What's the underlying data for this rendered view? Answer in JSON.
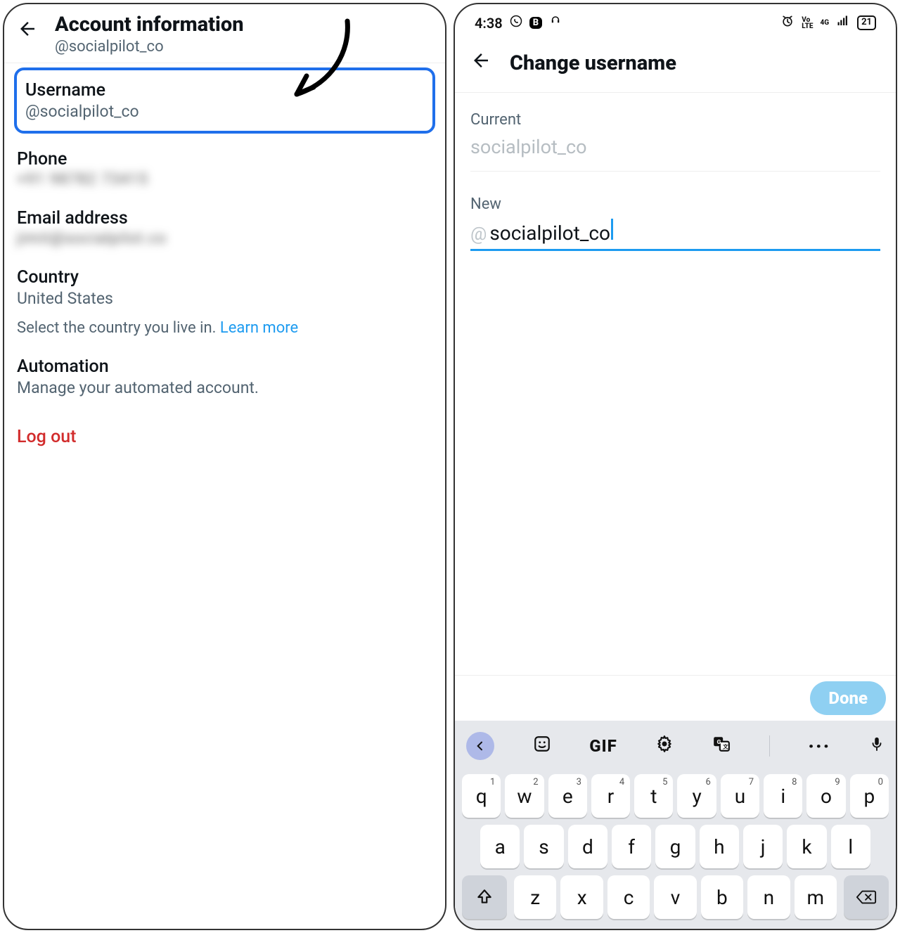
{
  "left": {
    "header": {
      "title": "Account information",
      "subtitle": "@socialpilot_co"
    },
    "username": {
      "label": "Username",
      "value": "@socialpilot_co"
    },
    "phone": {
      "label": "Phone",
      "value_blurred": "+91 98782 73415"
    },
    "email": {
      "label": "Email address",
      "value_blurred": "jimit@socialpilot.co"
    },
    "country": {
      "label": "Country",
      "value": "United States",
      "help_prefix": "Select the country you live in. ",
      "learn_more": "Learn more"
    },
    "automation": {
      "label": "Automation",
      "value": "Manage your automated account."
    },
    "logout": "Log out"
  },
  "right": {
    "statusbar": {
      "time": "4:38",
      "battery": "21"
    },
    "header": {
      "title": "Change username"
    },
    "current": {
      "label": "Current",
      "value": "socialpilot_co"
    },
    "neu": {
      "label": "New",
      "value": "socialpilot_co"
    },
    "done": "Done",
    "keyboard": {
      "gif": "GIF",
      "row1": [
        "q",
        "w",
        "e",
        "r",
        "t",
        "y",
        "u",
        "i",
        "o",
        "p"
      ],
      "row1_sup": [
        "1",
        "2",
        "3",
        "4",
        "5",
        "6",
        "7",
        "8",
        "9",
        "0"
      ],
      "row2": [
        "a",
        "s",
        "d",
        "f",
        "g",
        "h",
        "j",
        "k",
        "l"
      ],
      "row3": [
        "z",
        "x",
        "c",
        "v",
        "b",
        "n",
        "m"
      ]
    }
  }
}
